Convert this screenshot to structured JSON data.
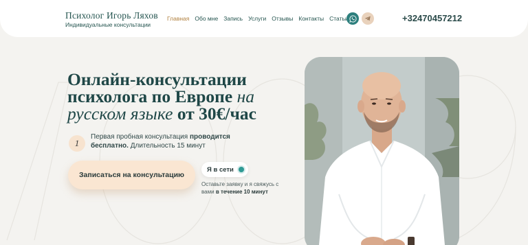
{
  "header": {
    "brand_name": "Психолог Игорь Ляхов",
    "brand_sub": "Индивидуальные консультации",
    "nav": [
      {
        "label": "Главная",
        "active": true
      },
      {
        "label": "Обо мне",
        "active": false
      },
      {
        "label": "Запись",
        "active": false
      },
      {
        "label": "Услуги",
        "active": false
      },
      {
        "label": "Отзывы",
        "active": false
      },
      {
        "label": "Контакты",
        "active": false
      },
      {
        "label": "Статьи",
        "active": false
      }
    ],
    "social": [
      "whatsapp-icon",
      "telegram-icon"
    ],
    "phone": "+32470457212"
  },
  "hero": {
    "headline_part1": "Онлайн-консультации психолога по Европе ",
    "headline_italic1": "на русском языке",
    "headline_part2": " от 30€/час",
    "badge_number": "1",
    "trial_part1": "Первая пробная консультация ",
    "trial_bold": "проводится бесплатно.",
    "trial_part2": " Длительность 15 минут",
    "cta_label": "Записаться на консультацию",
    "online_label": "Я в сети",
    "reply_part1": "Оставьте заявку и я свяжусь с вами ",
    "reply_bold": "в течение 10 минут"
  },
  "colors": {
    "accent_teal": "#2d7f7d",
    "accent_peach": "#fae6d2",
    "nav_active": "#b07f3d",
    "headline": "#1f4747"
  }
}
